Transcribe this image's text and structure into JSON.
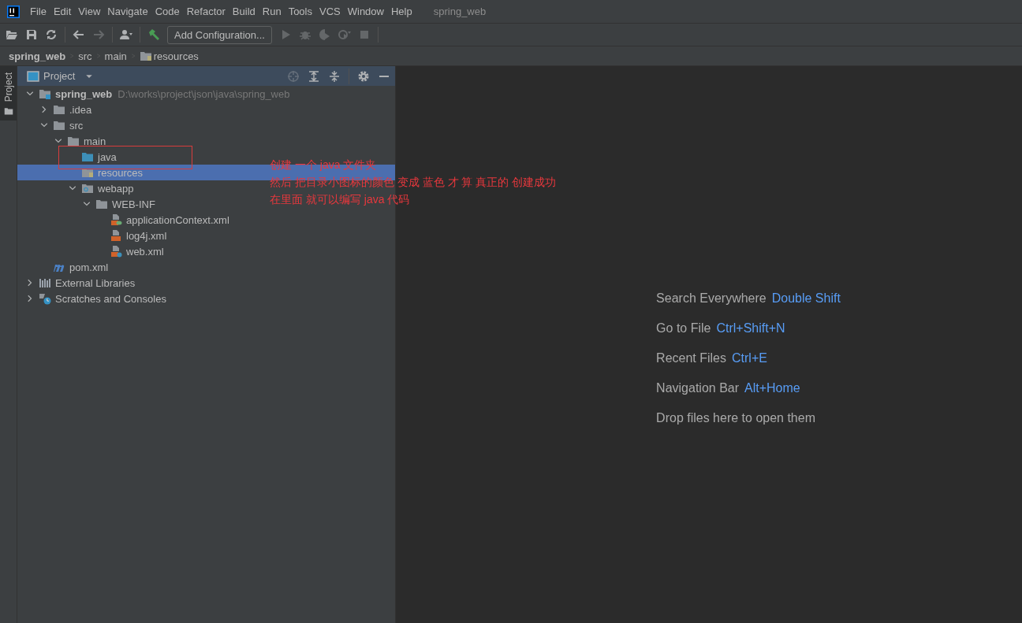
{
  "window": {
    "title": "spring_web"
  },
  "menu": [
    "File",
    "Edit",
    "View",
    "Navigate",
    "Code",
    "Refactor",
    "Build",
    "Run",
    "Tools",
    "VCS",
    "Window",
    "Help"
  ],
  "toolbar": [
    {
      "kind": "open",
      "disabled": false
    },
    {
      "kind": "save",
      "disabled": false
    },
    {
      "kind": "sync",
      "disabled": false
    },
    {
      "kind": "sep"
    },
    {
      "kind": "back",
      "disabled": false
    },
    {
      "kind": "forward",
      "disabled": true
    },
    {
      "kind": "sep"
    },
    {
      "kind": "user",
      "disabled": false
    },
    {
      "kind": "sep"
    },
    {
      "kind": "build",
      "disabled": false
    },
    {
      "kind": "config",
      "label": "Add Configuration...",
      "disabled": false
    },
    {
      "kind": "run",
      "disabled": true
    },
    {
      "kind": "debug",
      "disabled": true
    },
    {
      "kind": "coverage",
      "disabled": true
    },
    {
      "kind": "profile",
      "disabled": true
    },
    {
      "kind": "stop",
      "disabled": true
    },
    {
      "kind": "sep"
    }
  ],
  "breadcrumbs": [
    {
      "label": "spring_web",
      "kind": "module"
    },
    {
      "label": "src",
      "kind": "plain"
    },
    {
      "label": "main",
      "kind": "plain"
    },
    {
      "label": "resources",
      "kind": "resources-folder"
    }
  ],
  "side_tabs": [
    {
      "label": "Project",
      "selected": true
    }
  ],
  "project_panel": {
    "title": "Project",
    "tools": [
      {
        "kind": "locate",
        "disabled": true
      },
      {
        "kind": "expand",
        "disabled": false
      },
      {
        "kind": "collapse",
        "disabled": false
      },
      {
        "kind": "sep"
      },
      {
        "kind": "gear",
        "disabled": false
      },
      {
        "kind": "hide",
        "disabled": false
      }
    ],
    "tree": [
      {
        "label": "spring_web",
        "path": "D:\\works\\project\\json\\java\\spring_web",
        "kind": "module",
        "expanded": true,
        "selected": false,
        "children": [
          {
            "label": ".idea",
            "kind": "folder",
            "expanded": false,
            "selected": false
          },
          {
            "label": "src",
            "kind": "folder",
            "expanded": true,
            "selected": false,
            "children": [
              {
                "label": "main",
                "kind": "folder",
                "expanded": true,
                "selected": false,
                "children": [
                  {
                    "label": "java",
                    "kind": "source-folder",
                    "selected": false
                  },
                  {
                    "label": "resources",
                    "kind": "resources-folder",
                    "selected": true
                  },
                  {
                    "label": "webapp",
                    "kind": "web-folder",
                    "expanded": true,
                    "selected": false,
                    "children": [
                      {
                        "label": "WEB-INF",
                        "kind": "folder",
                        "expanded": true,
                        "selected": false,
                        "children": [
                          {
                            "label": "applicationContext.xml",
                            "kind": "xml-spring",
                            "selected": false
                          },
                          {
                            "label": "log4j.xml",
                            "kind": "xml",
                            "selected": false
                          },
                          {
                            "label": "web.xml",
                            "kind": "xml-web",
                            "selected": false
                          }
                        ]
                      }
                    ]
                  }
                ]
              }
            ]
          },
          {
            "label": "pom.xml",
            "kind": "maven",
            "selected": false
          }
        ]
      },
      {
        "label": "External Libraries",
        "kind": "libraries",
        "expanded": false,
        "selected": false
      },
      {
        "label": "Scratches and Consoles",
        "kind": "scratches",
        "expanded": false,
        "selected": false
      }
    ]
  },
  "annotation": {
    "lines": [
      "创建 一个 java 文件夹",
      "然后 把目录小图标的颜色 变成 蓝色 才 算 真正的 创建成功",
      "在里面 就可以编写 java 代码"
    ]
  },
  "editor_hints": [
    {
      "action": "Search Everywhere",
      "shortcut": "Double Shift"
    },
    {
      "action": "Go to File",
      "shortcut": "Ctrl+Shift+N"
    },
    {
      "action": "Recent Files",
      "shortcut": "Ctrl+E"
    },
    {
      "action": "Navigation Bar",
      "shortcut": "Alt+Home"
    },
    {
      "action": "Drop files here to open them"
    }
  ]
}
